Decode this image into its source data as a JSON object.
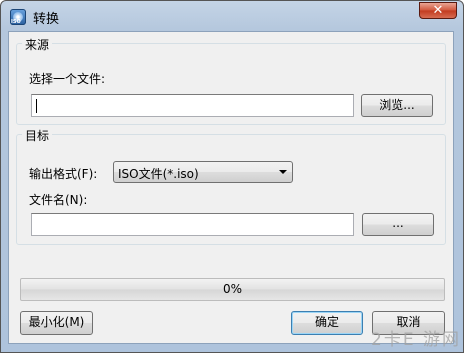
{
  "window": {
    "title": "转换",
    "close_symbol": "✕"
  },
  "app_icon": {
    "text": "ISO"
  },
  "source": {
    "group_title": "来源",
    "file_label": "选择一个文件:",
    "file_value": "",
    "browse_label": "浏览..."
  },
  "target": {
    "group_title": "目标",
    "format_label": "输出格式(F):",
    "format_value": "ISO文件(*.iso)",
    "filename_label": "文件名(N):",
    "filename_value": "",
    "ellipsis_label": "..."
  },
  "progress": {
    "value": 0,
    "label": "0%"
  },
  "footer": {
    "minimize_label": "最小化(M)",
    "ok_label": "确定",
    "cancel_label": "取消"
  },
  "watermark": {
    "text": "2卡E 游网"
  }
}
